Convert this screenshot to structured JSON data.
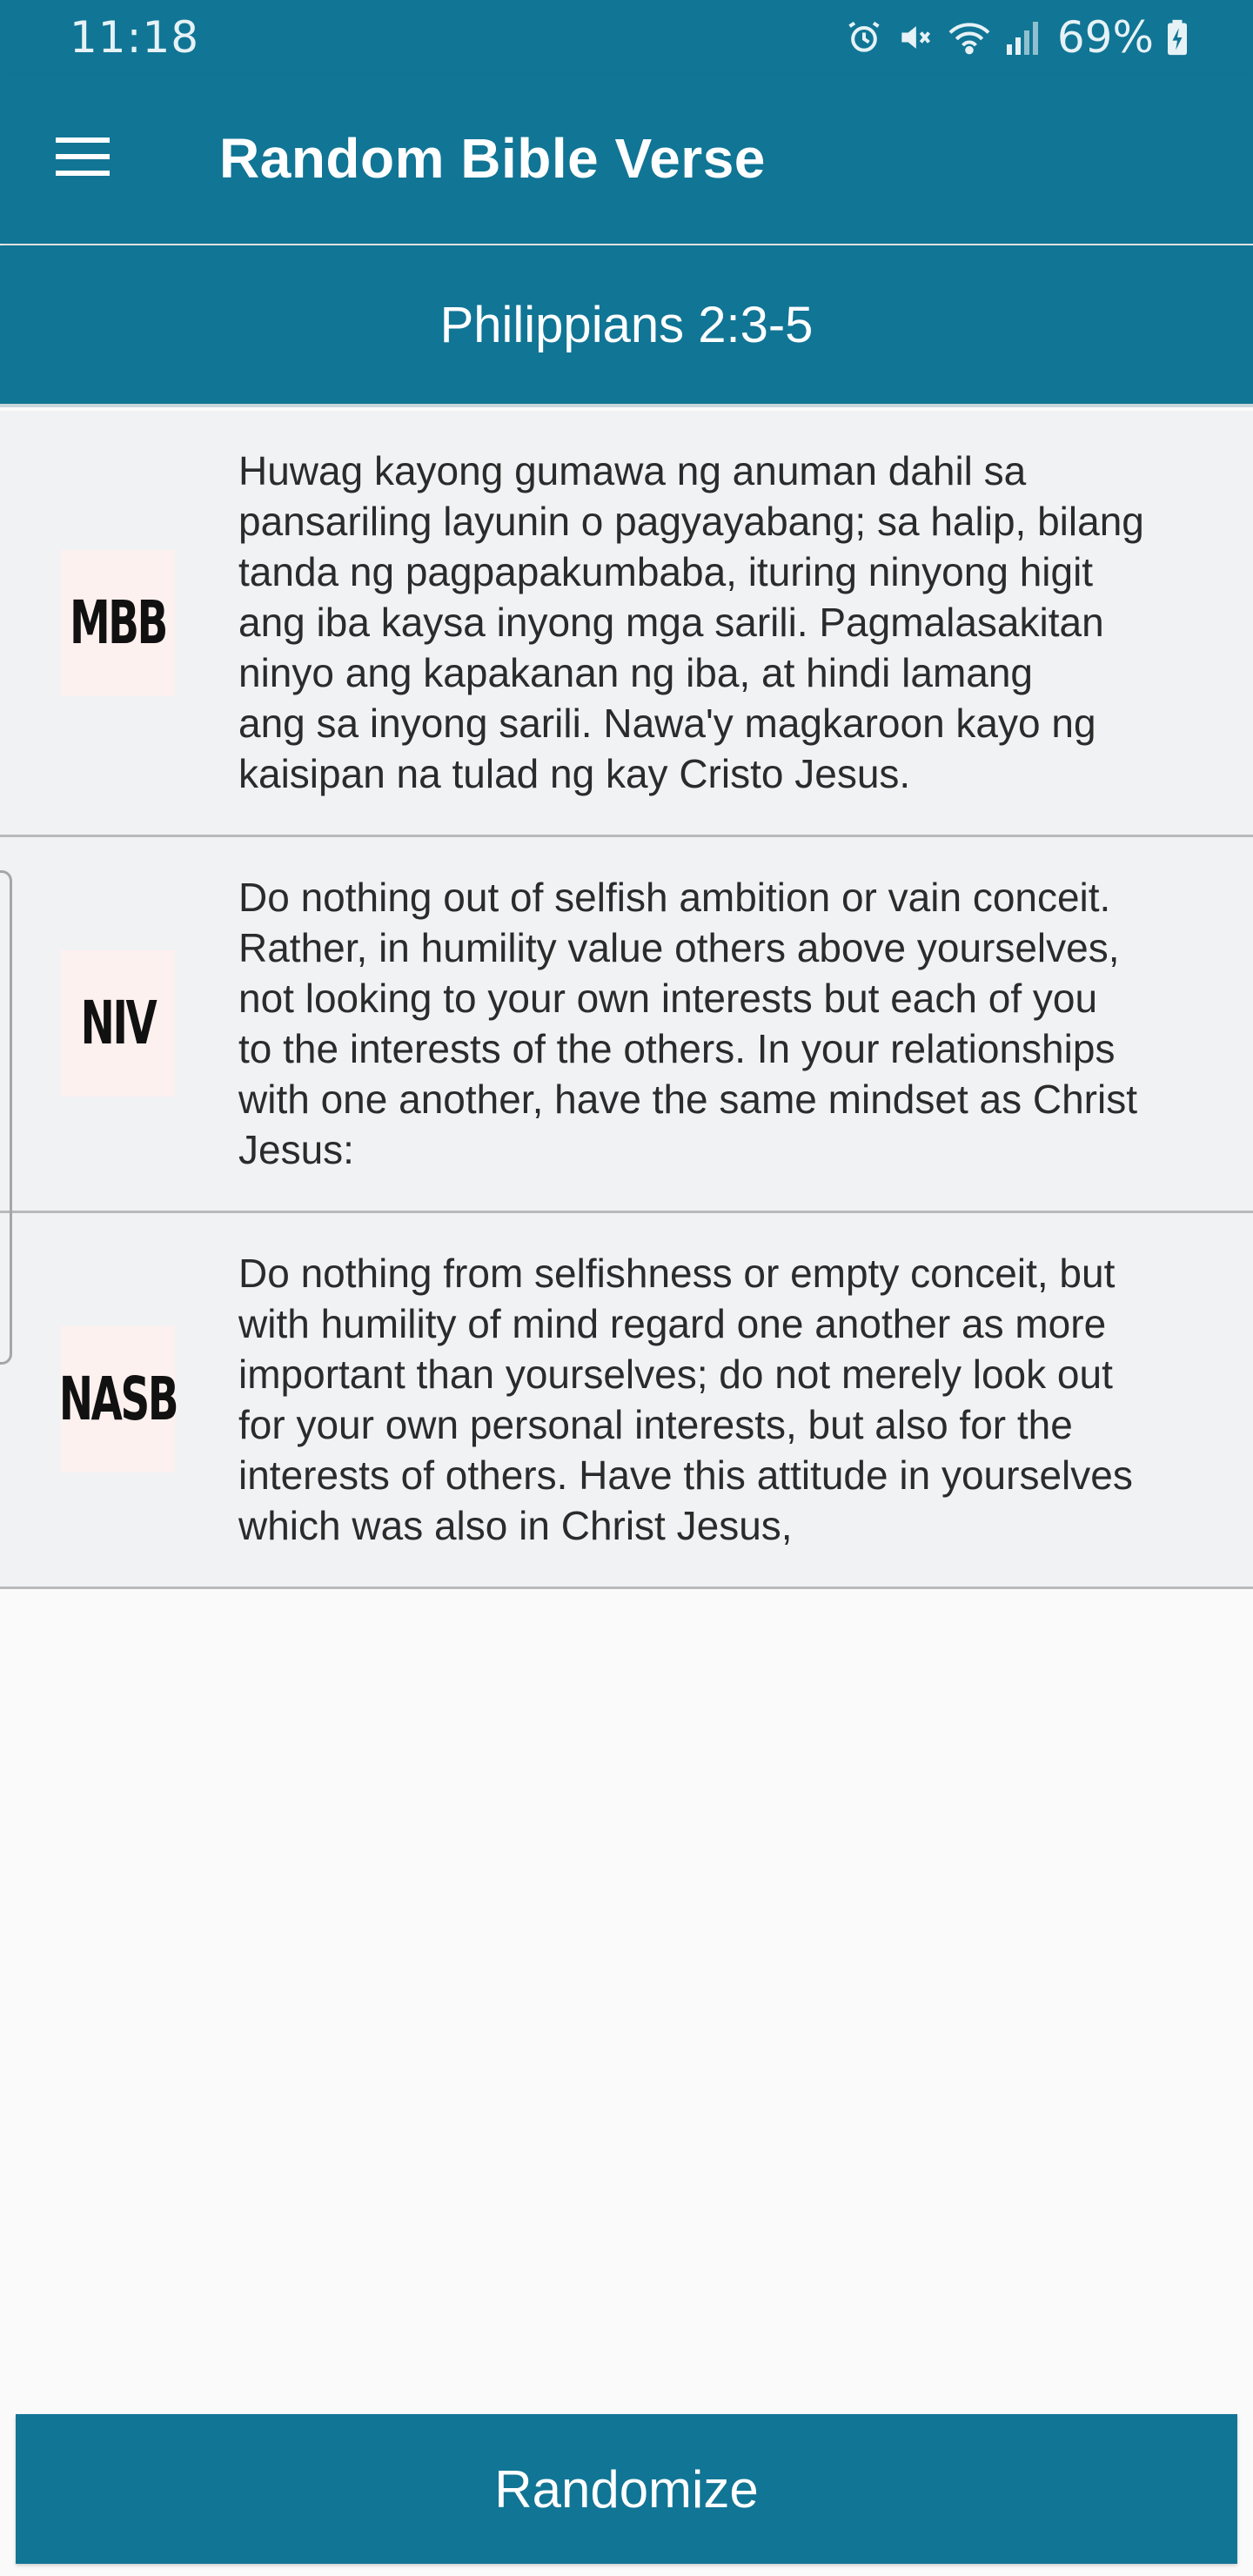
{
  "status_bar": {
    "time": "11:18",
    "battery_percent": "69%",
    "icons": [
      "alarm-icon",
      "mute-icon",
      "wifi-icon",
      "signal-icon",
      "battery-charging-icon"
    ]
  },
  "app_bar": {
    "menu_icon": "hamburger-menu-icon",
    "title": "Random Bible Verse"
  },
  "reference": "Philippians 2:3-5",
  "verses": [
    {
      "version": "MBB",
      "text": "Huwag kayong gumawa ng anuman dahil sa\npansariling layunin o pagyayabang; sa halip, bilang\ntanda ng pagpapakumbaba, ituring ninyong higit\nang iba kaysa inyong mga sarili. Pagmalasakitan\nninyo ang kapakanan ng iba, at hindi lamang\nang sa inyong sarili. Nawa'y magkaroon kayo ng\nkaisipan na tulad ng kay Cristo Jesus."
    },
    {
      "version": "NIV",
      "text": "Do nothing out of selfish ambition or vain conceit.\nRather, in humility value others above yourselves,\nnot looking to your own interests but each of you\nto the interests of the others. In your relationships\nwith one another, have the same mindset as Christ\nJesus:"
    },
    {
      "version": "NASB",
      "text": "Do nothing from selfishness or empty conceit, but\nwith humility of mind regard one another as more\nimportant than yourselves; do not merely look out\nfor your own personal interests, but also for the\ninterests of others. Have this attitude in yourselves\nwhich was also in Christ Jesus,"
    }
  ],
  "randomize_label": "Randomize",
  "colors": {
    "primary": "#117595",
    "card_background": "#f1f2f4",
    "page_background": "#fafafa"
  }
}
